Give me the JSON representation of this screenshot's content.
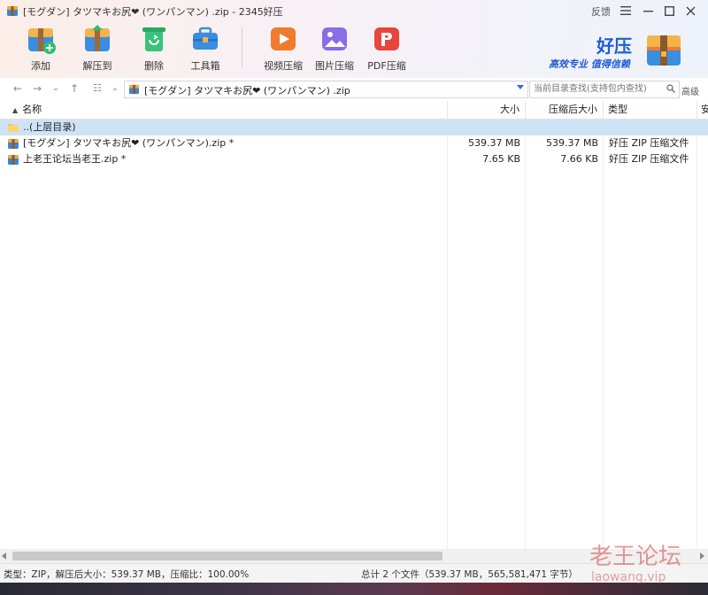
{
  "window": {
    "title": "[モグダン] タツマキお尻❤ (ワンパンマン) .zip - 2345好压",
    "feedback_label": "反馈"
  },
  "toolbar": {
    "items": [
      {
        "label": "添加",
        "icon": "add-archive-icon"
      },
      {
        "label": "解压到",
        "icon": "extract-icon"
      },
      {
        "label": "删除",
        "icon": "recycle-delete-icon"
      },
      {
        "label": "工具箱",
        "icon": "toolbox-icon"
      },
      {
        "label": "视频压缩",
        "icon": "video-compress-icon"
      },
      {
        "label": "图片压缩",
        "icon": "image-compress-icon"
      },
      {
        "label": "PDF压缩",
        "icon": "pdf-compress-icon"
      }
    ]
  },
  "brand": {
    "name": "好压",
    "slogan": "高效专业 值得信赖"
  },
  "address": {
    "path": "[モグダン] タツマキお尻❤ (ワンパンマン) .zip"
  },
  "search": {
    "placeholder": "当前目录查找(支持包内查找)",
    "advanced_label": "高级"
  },
  "columns": {
    "name": "名称",
    "size": "大小",
    "packed": "压缩后大小",
    "type": "类型",
    "extra": "安"
  },
  "files": [
    {
      "name": "..(上层目录)",
      "size": "",
      "packed": "",
      "type": "",
      "kind": "folder"
    },
    {
      "name": "[モグダン] タツマキお尻❤ (ワンパンマン).zip *",
      "size": "539.37 MB",
      "packed": "539.37 MB",
      "type": "好压 ZIP 压缩文件",
      "kind": "zip"
    },
    {
      "name": "上老王论坛当老王.zip *",
      "size": "7.65 KB",
      "packed": "7.66 KB",
      "type": "好压 ZIP 压缩文件",
      "kind": "zip"
    }
  ],
  "status": {
    "left": "类型：ZIP，解压后大小：539.37 MB，压缩比：100.00%",
    "right": "总计 2 个文件（539.37 MB，565,581,471 字节）"
  },
  "watermark": {
    "line1": "老王论坛",
    "line2": "laowang.vip"
  },
  "colors": {
    "accent": "#1e5bd6",
    "selection": "#cfe3f7"
  }
}
